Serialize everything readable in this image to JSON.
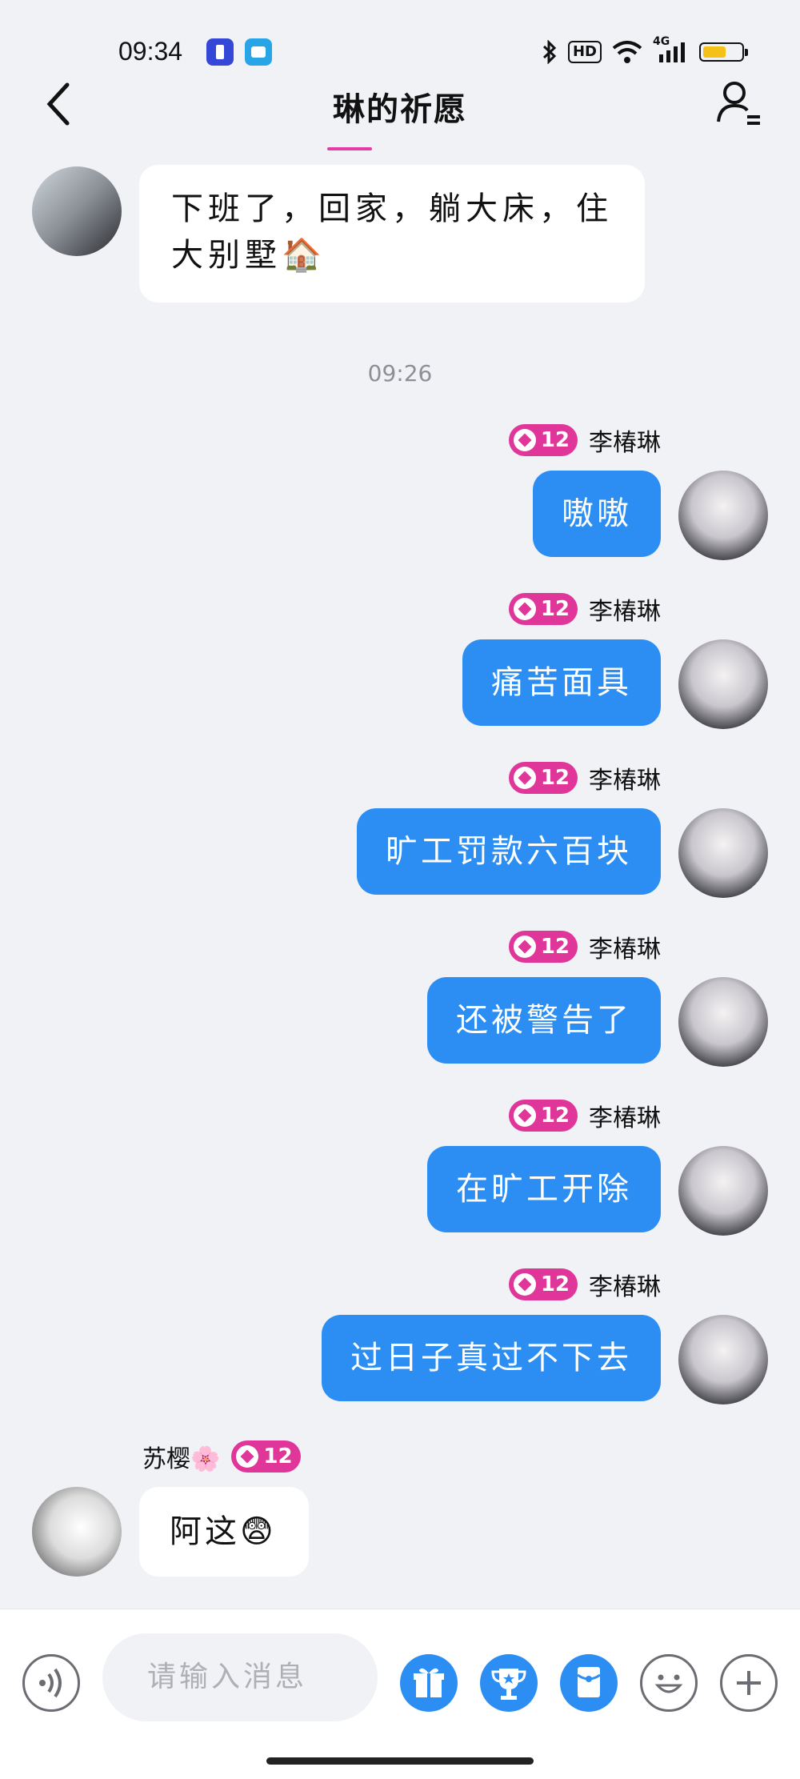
{
  "status_bar": {
    "time": "09:34",
    "network": "4G"
  },
  "header": {
    "title": "琳的祈愿"
  },
  "messages": [
    {
      "side": "left",
      "text": "下班了，回家，躺大床，住大别墅🏠"
    },
    {
      "timestamp": "09:26"
    },
    {
      "side": "right",
      "sender": "李椿琳",
      "level": "12",
      "text": "嗷嗷"
    },
    {
      "side": "right",
      "sender": "李椿琳",
      "level": "12",
      "text": "痛苦面具"
    },
    {
      "side": "right",
      "sender": "李椿琳",
      "level": "12",
      "text": "旷工罚款六百块"
    },
    {
      "side": "right",
      "sender": "李椿琳",
      "level": "12",
      "text": "还被警告了"
    },
    {
      "side": "right",
      "sender": "李椿琳",
      "level": "12",
      "text": "在旷工开除"
    },
    {
      "side": "right",
      "sender": "李椿琳",
      "level": "12",
      "text": "过日子真过不下去"
    },
    {
      "side": "left",
      "sender": "苏樱🌸",
      "level": "12",
      "text": "阿这😨"
    }
  ],
  "input": {
    "placeholder": "请输入消息"
  },
  "toolbar": {
    "icons": [
      "voice-icon",
      "gift-icon",
      "trophy-icon",
      "red-packet-icon",
      "emoji-icon",
      "plus-icon"
    ]
  },
  "colors": {
    "bubble_blue": "#2c8ef3",
    "badge_pink": "#e03599",
    "background": "#f1f2f6"
  }
}
